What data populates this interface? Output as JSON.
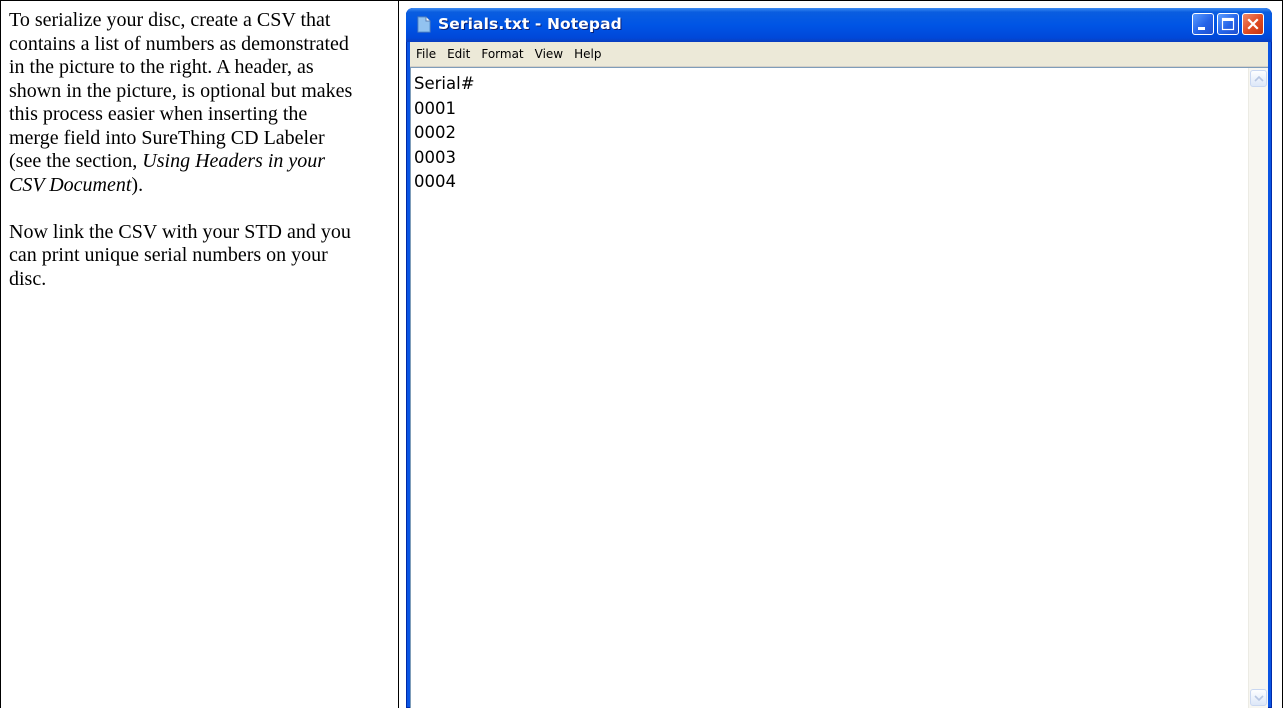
{
  "instructions": {
    "p1_before": "To serialize your disc, create a CSV that contains a list of numbers as demonstrated in the picture to the right.  A header, as shown in the picture, is optional but makes this process easier when inserting the merge field into SureThing CD Labeler (see the section, ",
    "p1_italic": "Using Headers in your CSV Document",
    "p1_after": ").",
    "p2": "Now link the CSV with your STD and you can print unique serial numbers on your disc."
  },
  "window": {
    "title": "Serials.txt - Notepad",
    "icon": "notepad-icon",
    "controls": [
      "minimize-icon",
      "maximize-icon",
      "close-icon"
    ],
    "menu": [
      "File",
      "Edit",
      "Format",
      "View",
      "Help"
    ],
    "content_lines": [
      "Serial#",
      "0001",
      "0002",
      "0003",
      "0004"
    ]
  },
  "colors": {
    "titlebar": "#0055e5",
    "close_button": "#df4a22",
    "menubar": "#ece9d8"
  }
}
